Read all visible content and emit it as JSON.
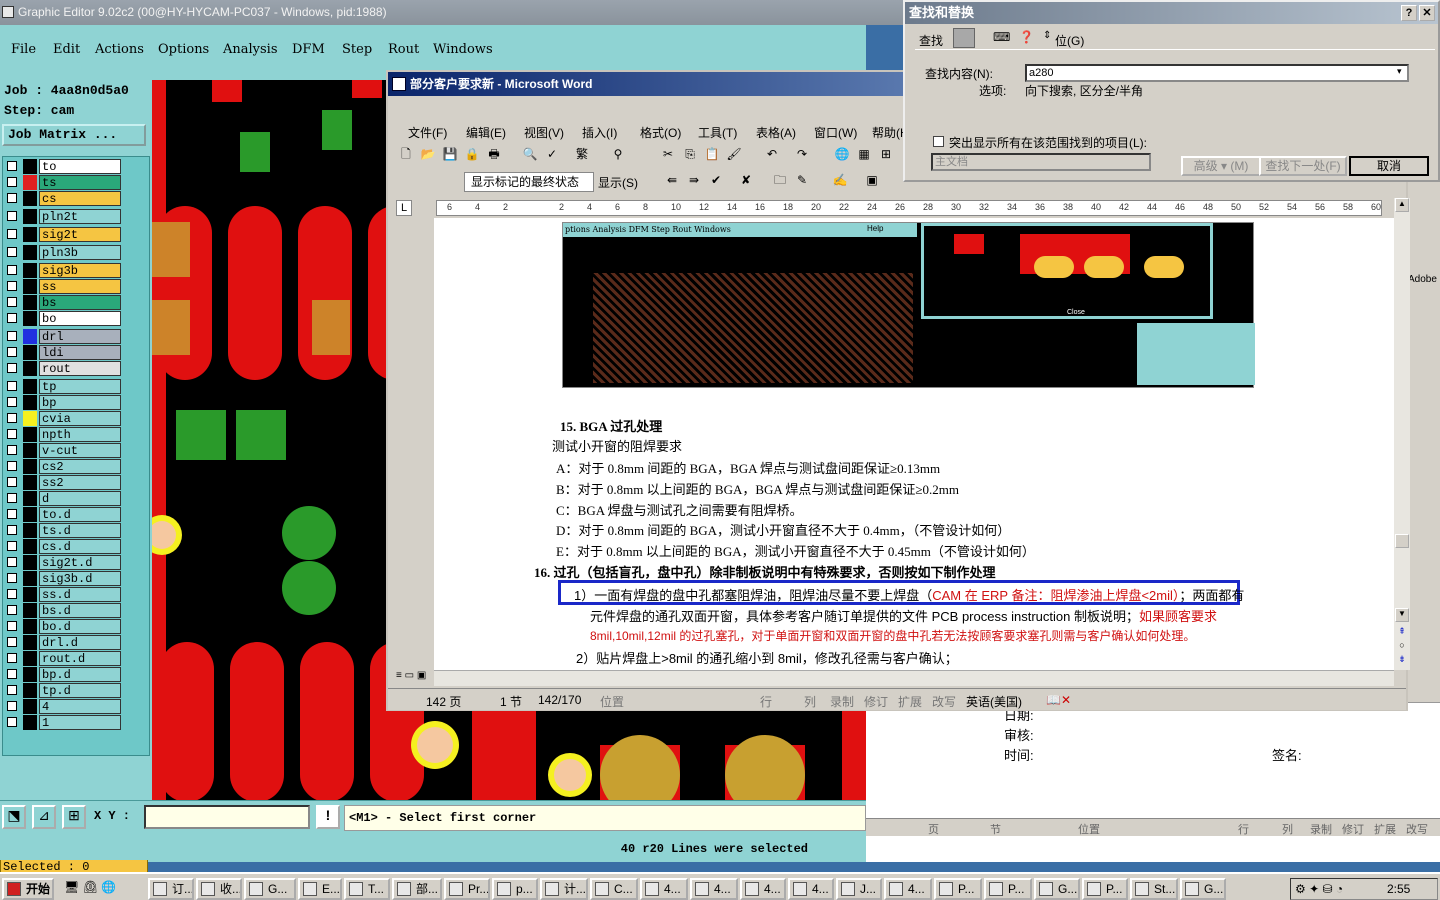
{
  "graphic_editor": {
    "title": "Graphic Editor 9.02c2 (00@HY-HYCAM-PC037 - Windows, pid:1988)",
    "menu": [
      "File",
      "Edit",
      "Actions",
      "Options",
      "Analysis",
      "DFM",
      "Step",
      "Rout",
      "Windows"
    ],
    "job_label": "Job : 4aa8n0d5a0",
    "step_label": "Step: cam",
    "job_matrix_button": "Job Matrix ...",
    "layers": [
      {
        "name": "to",
        "color": "#ffffff",
        "swatch": "#000000"
      },
      {
        "name": "ts",
        "color": "#2aa87a",
        "swatch": "#e02020"
      },
      {
        "name": "cs",
        "color": "#f5c542",
        "swatch": "#000000"
      },
      {
        "name": "pln2t",
        "color": "#8fd3d3",
        "swatch": "#000000"
      },
      {
        "name": "sig2t",
        "color": "#f5c542",
        "swatch": "#000000"
      },
      {
        "name": "pln3b",
        "color": "#8fd3d3",
        "swatch": "#000000"
      },
      {
        "name": "sig3b",
        "color": "#f5c542",
        "swatch": "#000000"
      },
      {
        "name": "ss",
        "color": "#f5c542",
        "swatch": "#000000"
      },
      {
        "name": "bs",
        "color": "#2aa87a",
        "swatch": "#000000"
      },
      {
        "name": "bo",
        "color": "#ffffff",
        "swatch": "#000000"
      },
      {
        "name": "drl",
        "color": "#a8b0bc",
        "swatch": "#2030e0"
      },
      {
        "name": "ldi",
        "color": "#a8b0bc",
        "swatch": "#000000"
      },
      {
        "name": "rout",
        "color": "#e0e0e0",
        "swatch": "#000000"
      },
      {
        "name": "tp",
        "color": "#8fd3d3",
        "swatch": "#000000"
      },
      {
        "name": "bp",
        "color": "#8fd3d3",
        "swatch": "#000000"
      },
      {
        "name": "cvia",
        "color": "#8fd3d3",
        "swatch": "#f5f020"
      },
      {
        "name": "npth",
        "color": "#8fd3d3",
        "swatch": "#000000"
      },
      {
        "name": "v-cut",
        "color": "#8fd3d3",
        "swatch": "#000000"
      },
      {
        "name": "cs2",
        "color": "#8fd3d3",
        "swatch": "#000000"
      },
      {
        "name": "ss2",
        "color": "#8fd3d3",
        "swatch": "#000000"
      },
      {
        "name": "d",
        "color": "#8fd3d3",
        "swatch": "#000000"
      },
      {
        "name": "to.d",
        "color": "#8fd3d3",
        "swatch": "#000000"
      },
      {
        "name": "ts.d",
        "color": "#8fd3d3",
        "swatch": "#000000"
      },
      {
        "name": "cs.d",
        "color": "#8fd3d3",
        "swatch": "#000000"
      },
      {
        "name": "sig2t.d",
        "color": "#8fd3d3",
        "swatch": "#000000"
      },
      {
        "name": "sig3b.d",
        "color": "#8fd3d3",
        "swatch": "#000000"
      },
      {
        "name": "ss.d",
        "color": "#8fd3d3",
        "swatch": "#000000"
      },
      {
        "name": "bs.d",
        "color": "#8fd3d3",
        "swatch": "#000000"
      },
      {
        "name": "bo.d",
        "color": "#8fd3d3",
        "swatch": "#000000"
      },
      {
        "name": "drl.d",
        "color": "#8fd3d3",
        "swatch": "#000000"
      },
      {
        "name": "rout.d",
        "color": "#8fd3d3",
        "swatch": "#000000"
      },
      {
        "name": "bp.d",
        "color": "#8fd3d3",
        "swatch": "#000000"
      },
      {
        "name": "tp.d",
        "color": "#8fd3d3",
        "swatch": "#000000"
      },
      {
        "name": "4",
        "color": "#8fd3d3",
        "swatch": "#000000"
      },
      {
        "name": "1",
        "color": "#8fd3d3",
        "swatch": "#000000"
      }
    ],
    "selected_label": "Selected : 0",
    "xy_label": "X Y :",
    "prompt": "<M1> - Select first corner",
    "status": "40 r20 Lines were selected"
  },
  "word": {
    "title": "部分客户要求新 - Microsoft Word",
    "menu": [
      "文件(F)",
      "编辑(E)",
      "视图(V)",
      "插入(I)",
      "格式(O)",
      "工具(T)",
      "表格(A)",
      "窗口(W)",
      "帮助(H)"
    ],
    "markup_dropdown": "显示标记的最终状态",
    "show_button": "显示(S)",
    "ruler_numbers": [
      "6",
      "4",
      "2",
      "",
      "2",
      "4",
      "6",
      "8",
      "10",
      "12",
      "14",
      "16",
      "18",
      "20",
      "22",
      "24",
      "26",
      "28",
      "30",
      "32",
      "34",
      "36",
      "38",
      "40",
      "42",
      "44",
      "46",
      "48",
      "50",
      "52",
      "54",
      "56",
      "58",
      "60"
    ],
    "embedded_menu": "ptions Analysis DFM Step Rout Windows",
    "embedded_help": "Help",
    "embedded_close": "Close",
    "doc_lines": [
      {
        "text": "15.  BGA 过孔处理",
        "bold": true
      },
      {
        "text": "测试小开窗的阻焊要求"
      },
      {
        "text": "A：对于 0.8mm 间距的 BGA，BGA 焊点与测试盘间距保证≥0.13mm"
      },
      {
        "text": "B：对于 0.8mm 以上间距的 BGA，BGA 焊点与测试盘间距保证≥0.2mm"
      },
      {
        "text": "C：BGA 焊盘与测试孔之间需要有阻焊桥。"
      },
      {
        "text": "D：对于 0.8mm 间距的 BGA，测试小开窗直径不大于 0.4mm，（不管设计如何）"
      },
      {
        "text": "E：对于 0.8mm 以上间距的 BGA，测试小开窗直径不大于 0.45mm（不管设计如何）"
      },
      {
        "text": "16.  过孔（包括盲孔，盘中孔）除非制板说明中有特殊要求，否则按如下制作处理",
        "bold": true
      }
    ],
    "item1_prefix": "1）一面有焊盘的盘中孔都塞阻焊油，阻焊油尽量不要上焊盘（",
    "item1_red": "CAM 在 ERP 备注：阻焊渗油上焊盘<2mil）",
    "item1_suffix": "；两面都有",
    "item1_line2_black": "元件焊盘的通孔双面开窗，具体参考客户随订单提供的文件 PCB process instruction 制板说明；",
    "item1_line2_red": "如果顾客要求",
    "item1_line3_red": "8mil,10mil,12mil 的过孔塞孔，对于单面开窗和双面开窗的盘中孔若无法按顾客要求塞孔则需与客户确认如何处理。",
    "item2": "2）贴片焊盘上>8mil 的通孔缩小到 8mil，修改孔径需与客户确认；",
    "status": {
      "page": "142 页",
      "section": "1 节",
      "pages": "142/170",
      "position": "位置",
      "line": "行",
      "col": "列",
      "rec": "录制",
      "trk": "修订",
      "ext": "扩展",
      "ovr": "改写",
      "lang": "英语(美国)"
    }
  },
  "find_dialog": {
    "title": "查找和替换",
    "tab_find": "查找",
    "tab_goto": "位(G)",
    "find_label": "查找内容(N):",
    "find_value": "a280",
    "options_label": "选项:",
    "options_value": "向下搜索, 区分全/半角",
    "highlight_label": "突出显示所有在该范围找到的项目(L):",
    "scope_value": "主文档",
    "advanced_button": "高级 ▾ (M)",
    "find_next_button": "查找下一处(F)",
    "cancel_button": "取消"
  },
  "bg_app": {
    "label_adobe": "Adobe",
    "row_audit": "审核:",
    "row_time": "时间:",
    "row_sign": "签名:",
    "row_top": "日期:",
    "status": [
      "页",
      "节",
      "位置",
      "行",
      "列",
      "录制",
      "修订",
      "扩展",
      "改写"
    ]
  },
  "taskbar": {
    "start": "开始",
    "tasks": [
      "订...",
      "收...",
      "G...",
      "E...",
      "T...",
      "部...",
      "Pr...",
      "p...",
      "计...",
      "C...",
      "4...",
      "4...",
      "4...",
      "4...",
      "J...",
      "4...",
      "P...",
      "P...",
      "G...",
      "P...",
      "St...",
      "G..."
    ],
    "clock": "2:55"
  }
}
